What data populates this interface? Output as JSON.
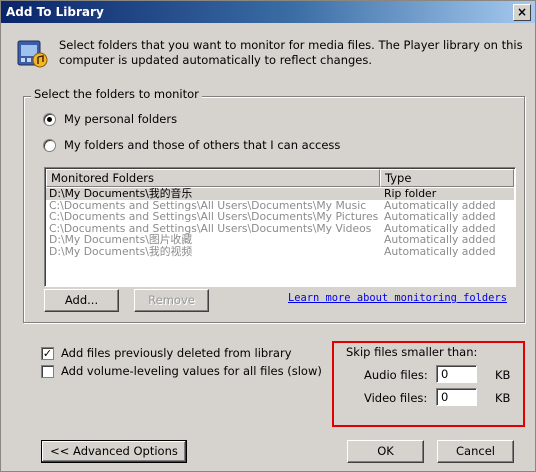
{
  "dialog": {
    "title": "Add To Library",
    "close_glyph": "×",
    "description": "Select folders that you want to monitor for media files. The Player library on this computer is updated automatically to reflect changes."
  },
  "select_group": {
    "title": "Select the folders to monitor",
    "radio_personal": {
      "label": "My personal folders",
      "selected": true
    },
    "radio_all": {
      "label": "My folders and those of others that I can access",
      "selected": false
    }
  },
  "folder_list": {
    "columns": [
      "Monitored Folders",
      "Type"
    ],
    "rows": [
      {
        "folder": "D:\\My Documents\\我的音乐",
        "type": "Rip folder",
        "selected": true
      },
      {
        "folder": "C:\\Documents and Settings\\All Users\\Documents\\My Music",
        "type": "Automatically added",
        "selected": false
      },
      {
        "folder": "C:\\Documents and Settings\\All Users\\Documents\\My Pictures",
        "type": "Automatically added",
        "selected": false
      },
      {
        "folder": "C:\\Documents and Settings\\All Users\\Documents\\My Videos",
        "type": "Automatically added",
        "selected": false
      },
      {
        "folder": "D:\\My Documents\\图片收藏",
        "type": "Automatically added",
        "selected": false
      },
      {
        "folder": "D:\\My Documents\\我的视频",
        "type": "Automatically added",
        "selected": false
      }
    ]
  },
  "buttons": {
    "add": "Add...",
    "remove": "Remove",
    "advanced": "<< Advanced Options",
    "ok": "OK",
    "cancel": "Cancel"
  },
  "learn_more_link": "Learn more about monitoring folders",
  "options": {
    "add_deleted": {
      "label": "Add files previously deleted from library",
      "checked": true
    },
    "volume_leveling": {
      "label": "Add volume-leveling values for all files (slow)",
      "checked": false
    }
  },
  "skip": {
    "title": "Skip files smaller than:",
    "audio_label": "Audio files:",
    "audio_value": "0",
    "video_label": "Video files:",
    "video_value": "0",
    "unit": "KB"
  },
  "colors": {
    "highlight_box": "#e00000",
    "link": "#0000ee",
    "title_bar": "#0a246a"
  }
}
